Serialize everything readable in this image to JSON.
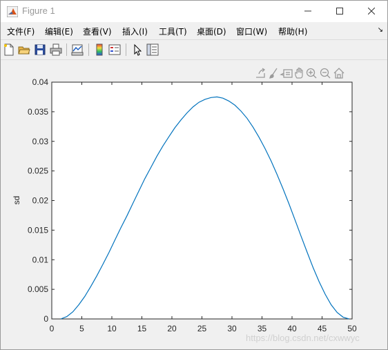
{
  "window": {
    "title": "Figure 1"
  },
  "menu": [
    "文件(F)",
    "编辑(E)",
    "查看(V)",
    "插入(I)",
    "工具(T)",
    "桌面(D)",
    "窗口(W)",
    "帮助(H)"
  ],
  "toolbar_icons": [
    "new-figure-icon",
    "open-file-icon",
    "save-icon",
    "print-icon",
    "link-plot-icon",
    "insert-colorbar-icon",
    "insert-legend-icon",
    "edit-plot-icon",
    "property-inspector-icon"
  ],
  "axes_toolbar_icons": [
    "export-icon",
    "brush-icon",
    "data-tips-icon",
    "pan-icon",
    "zoom-in-icon",
    "zoom-out-icon",
    "home-icon"
  ],
  "watermark": "https://blog.csdn.net/cxwwyc",
  "chart_data": {
    "type": "line",
    "ylabel": "sd",
    "xlabel": "",
    "title": "",
    "xlim": [
      0,
      50
    ],
    "ylim": [
      0,
      0.04
    ],
    "xticks": [
      "0",
      "5",
      "10",
      "15",
      "20",
      "25",
      "30",
      "35",
      "40",
      "45",
      "50"
    ],
    "yticks": [
      "0",
      "0.005",
      "0.01",
      "0.015",
      "0.02",
      "0.025",
      "0.03",
      "0.035",
      "0.04"
    ],
    "series": [
      {
        "color": "#0072bd",
        "x": [
          1.5,
          2.5,
          3.5,
          4.5,
          5.5,
          6.5,
          7.5,
          8.5,
          9.5,
          10.5,
          11.5,
          12.5,
          13.5,
          14.5,
          15.5,
          16.5,
          17.5,
          18.5,
          19.5,
          20.5,
          21.5,
          22.5,
          23.5,
          24.5,
          25.5,
          26.5,
          27.5,
          28.5,
          29.5,
          30.5,
          31.5,
          32.5,
          33.5,
          34.5,
          35.5,
          36.5,
          37.5,
          38.5,
          39.5,
          40.5,
          41.5,
          42.5,
          43.5,
          44.5,
          45.5,
          46.5,
          47.5,
          48.5,
          49.5
        ],
        "y": [
          0.0,
          0.0004,
          0.0012,
          0.0024,
          0.0038,
          0.0055,
          0.0073,
          0.0092,
          0.0112,
          0.0133,
          0.0154,
          0.0174,
          0.0195,
          0.0216,
          0.0237,
          0.0256,
          0.0275,
          0.0292,
          0.0308,
          0.0323,
          0.0336,
          0.0348,
          0.0358,
          0.0366,
          0.0371,
          0.0374,
          0.0375,
          0.0373,
          0.0368,
          0.0361,
          0.0351,
          0.0339,
          0.0324,
          0.0307,
          0.0288,
          0.0267,
          0.0244,
          0.022,
          0.0194,
          0.0167,
          0.014,
          0.0113,
          0.0087,
          0.0063,
          0.0042,
          0.0024,
          0.0011,
          0.0003,
          0.0
        ]
      }
    ]
  }
}
